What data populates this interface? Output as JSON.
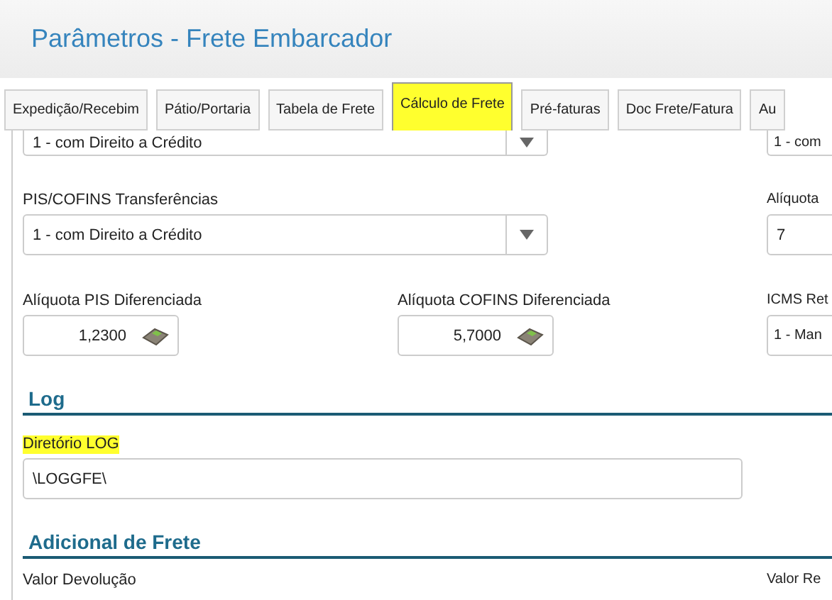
{
  "header": {
    "title": "Parâmetros - Frete Embarcador"
  },
  "tabs": [
    {
      "label": "Expedição/Recebim",
      "selected": false,
      "highlighted": false
    },
    {
      "label": "Pátio/Portaria",
      "selected": false,
      "highlighted": false
    },
    {
      "label": "Tabela de Frete",
      "selected": false,
      "highlighted": false
    },
    {
      "label": "Cálculo de Frete",
      "selected": true,
      "highlighted": true
    },
    {
      "label": "Pré-faturas",
      "selected": false,
      "highlighted": false
    },
    {
      "label": "Doc Frete/Fatura",
      "selected": false,
      "highlighted": false
    },
    {
      "label": "Au",
      "selected": false,
      "highlighted": false
    }
  ],
  "rows": [
    {
      "fields": [
        {
          "kind": "select",
          "value": "1 - com Direito a Crédito",
          "wide": true,
          "cut_top": true
        },
        {
          "kind": "none"
        },
        {
          "kind": "select",
          "value": "1 - com",
          "wide": false,
          "cut_top": true
        }
      ]
    },
    {
      "fields": [
        {
          "kind": "select",
          "label": "PIS/COFINS Transferências",
          "value": "1 - com Direito a Crédito",
          "wide": true,
          "cut_top": false
        },
        {
          "kind": "none"
        },
        {
          "kind": "number",
          "label": "Alíquota",
          "value": "7"
        }
      ]
    },
    {
      "fields": [
        {
          "kind": "calc",
          "label": "Alíquota PIS Diferenciada",
          "value": "1,2300"
        },
        {
          "kind": "calc",
          "label": "Alíquota COFINS Diferenciada",
          "value": "5,7000"
        },
        {
          "kind": "select",
          "label": "ICMS Ret",
          "value": "1 - Man",
          "cut_top": false
        }
      ]
    }
  ],
  "sections": [
    {
      "title": "Log",
      "fields": [
        {
          "label": "Diretório LOG",
          "value": "\\LOGGFE\\",
          "highlighted": true
        }
      ]
    },
    {
      "title": "Adicional de Frete",
      "labels": [
        "Valor Devolução",
        "Valor Re"
      ]
    }
  ]
}
